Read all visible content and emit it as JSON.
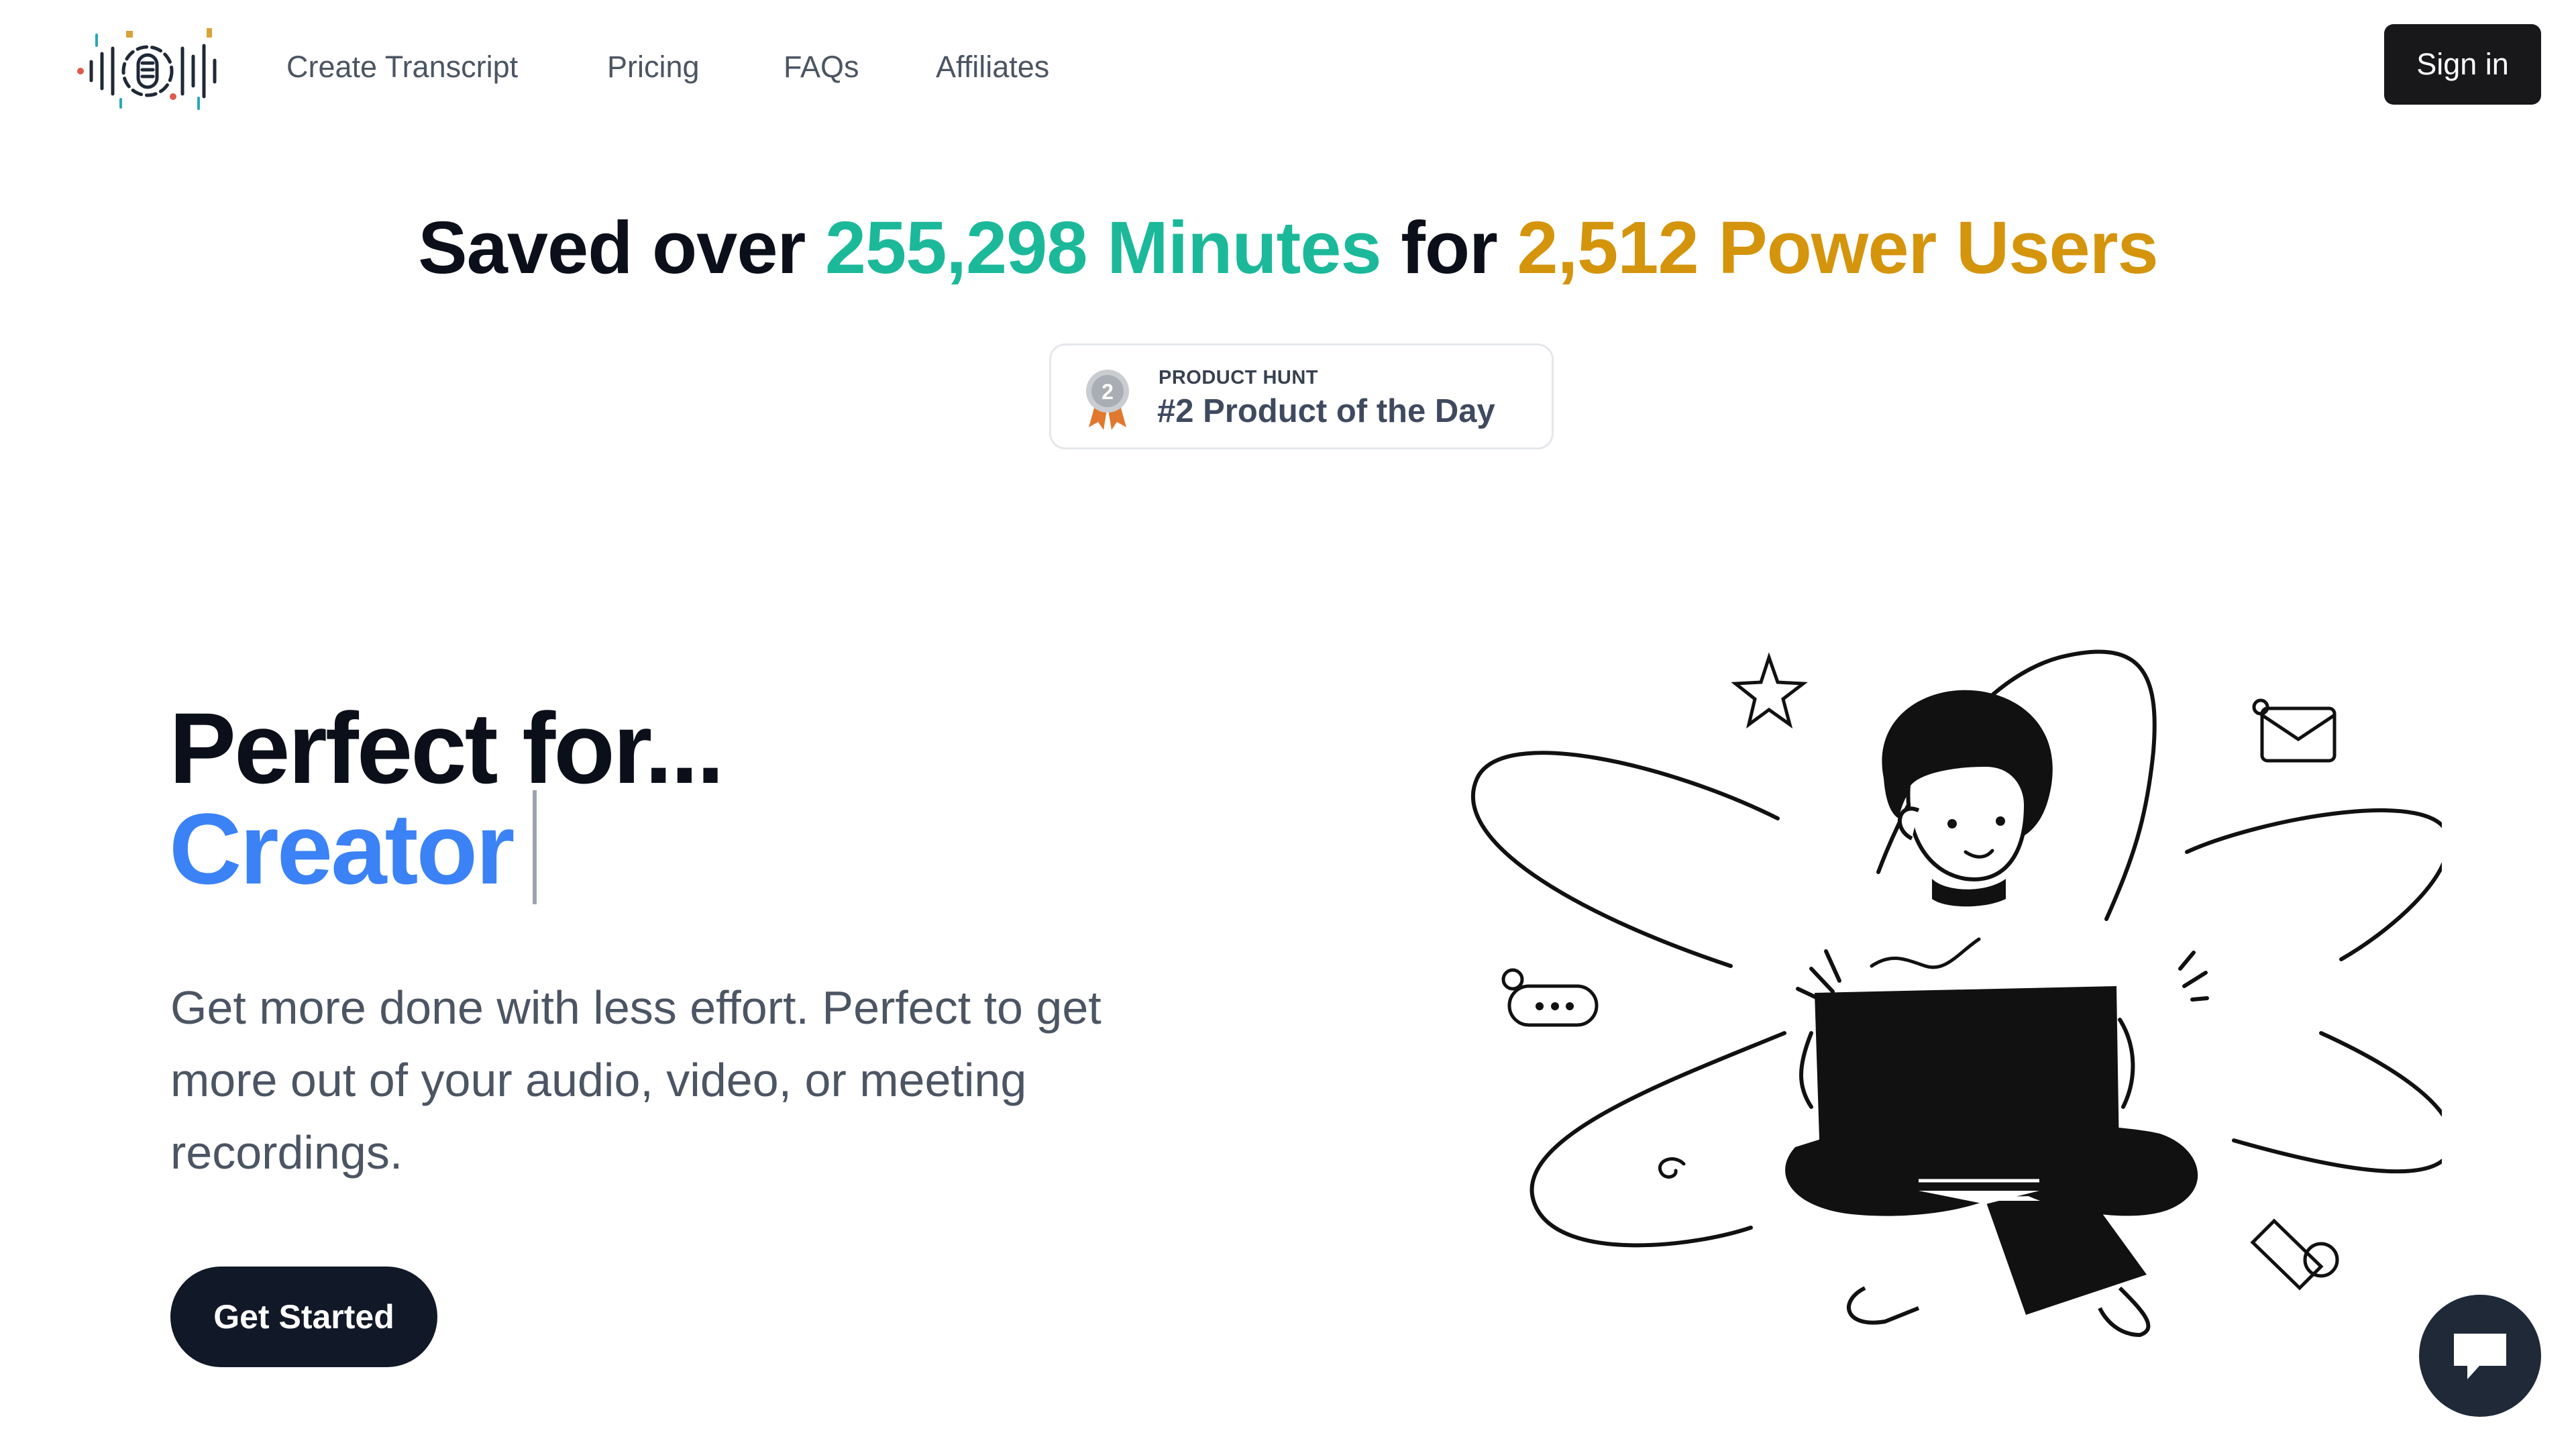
{
  "header": {
    "nav": [
      {
        "label": "Create Transcript"
      },
      {
        "label": "Pricing"
      },
      {
        "label": "FAQs"
      },
      {
        "label": "Affiliates"
      }
    ],
    "sign_in_label": "Sign in"
  },
  "stats": {
    "prefix": "Saved over",
    "minutes_value": "255,298",
    "minutes_label": "Minutes",
    "middle": "for",
    "users_value": "2,512",
    "users_label": "Power Users"
  },
  "badge": {
    "rank_number": "2",
    "source": "PRODUCT HUNT",
    "text": "#2 Product of the Day"
  },
  "hero": {
    "title": "Perfect for...",
    "role": "Creator",
    "description": "Get more done with less effort. Perfect to get more out of your audio, video, or meeting recordings.",
    "cta_label": "Get Started"
  },
  "colors": {
    "accent_teal": "#1bb99a",
    "accent_gold": "#d4940c",
    "accent_blue": "#3b82f6",
    "dark": "#111827"
  },
  "icons": {
    "logo": "waveform-logo",
    "medal": "medal-icon",
    "chat": "chat-bubble-icon"
  }
}
